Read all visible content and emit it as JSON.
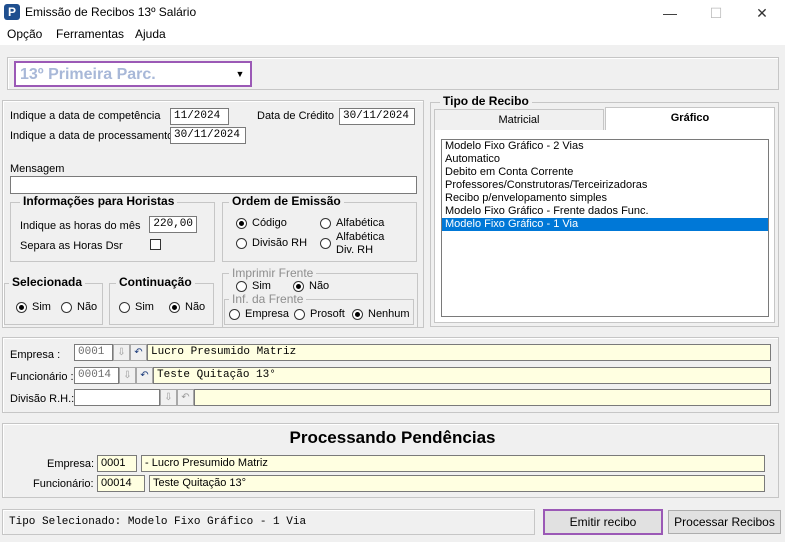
{
  "window": {
    "title": "Emissão de Recibos 13º Salário",
    "icon_letter": "P",
    "minimize": "—",
    "maximize": "☐",
    "close": "✕"
  },
  "menu": [
    "Opção",
    "Ferramentas",
    "Ajuda"
  ],
  "parcela_combo": {
    "value": "13º Primeira Parc.",
    "arrow": "▼"
  },
  "dates": {
    "competencia_label": "Indique a data de competência",
    "competencia_value": "11/2024",
    "credito_label": "Data de Crédito",
    "credito_value": "30/11/2024",
    "processamento_label": "Indique a data de processamento",
    "processamento_value": "30/11/2024"
  },
  "mensagem": {
    "label": "Mensagem",
    "value": ""
  },
  "horistas": {
    "title": "Informações para Horistas",
    "horas_label": "Indique as horas do mês",
    "horas_value": "220,00",
    "dsr_label": "Separa as Horas Dsr"
  },
  "ordem": {
    "title": "Ordem de Emissão",
    "codigo": "Código",
    "alfabetica": "Alfabética",
    "divisao": "Divisão RH",
    "alfabetica_div": "Alfabética",
    "alfabetica_div_2": "Div.  RH"
  },
  "selecionada": {
    "title": "Selecionada",
    "sim": "Sim",
    "nao": "Não"
  },
  "continuacao": {
    "title": "Continuação",
    "sim": "Sim",
    "nao": "Não"
  },
  "imprimir_frente": {
    "title": "Imprimir Frente",
    "sim": "Sim",
    "nao": "Não"
  },
  "inf_frente": {
    "title": "Inf. da Frente",
    "empresa": "Empresa",
    "prosoft": "Prosoft",
    "nenhum": "Nenhum"
  },
  "tipo_recibo": {
    "title": "Tipo de Recibo",
    "tabs": [
      "Matricial",
      "Gráfico"
    ],
    "items": [
      "Modelo Fixo Gráfico - 2 Vias",
      "Automatico",
      "Debito em Conta Corrente",
      "Professores/Construtoras/Terceirizadoras",
      "Recibo p/envelopamento simples",
      "Modelo Fixo Gráfico - Frente dados Func.",
      "Modelo Fixo Gráfico - 1 Via"
    ]
  },
  "selection": {
    "empresa_label": "Empresa :",
    "empresa_code": "0001",
    "empresa_name": "Lucro Presumido Matriz",
    "funcionario_label": "Funcionário :",
    "funcionario_code": "00014",
    "funcionario_name": "Teste Quitação 13°",
    "divisao_label": "Divisão R.H.:",
    "divisao_code": "",
    "divisao_name": ""
  },
  "pendencias": {
    "title": "Processando Pendências",
    "empresa_label": "Empresa:",
    "empresa_code": "0001",
    "empresa_name": "- Lucro Presumido Matriz",
    "funcionario_label": "Funcionário:",
    "funcionario_code": "00014",
    "funcionario_name": "Teste Quitação 13°"
  },
  "status": {
    "text": "Tipo Selecionado: Modelo Fixo Gráfico - 1 Via"
  },
  "buttons": {
    "emitir": "Emitir recibo",
    "processar": "Processar Recibos"
  },
  "colors": {
    "highlight": "#9b59b6",
    "selection": "#0078d7",
    "field_yellow": "#ffffe1"
  }
}
